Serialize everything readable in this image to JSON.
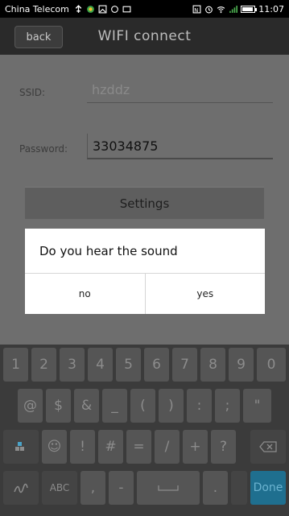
{
  "status_bar": {
    "carrier": "China Telecom",
    "time": "11:07",
    "battery_level": 0.8
  },
  "header": {
    "back_label": "back",
    "title": "WIFI connect"
  },
  "form": {
    "ssid_label": "SSID:",
    "ssid_value": "hzddz",
    "password_label": "Password:",
    "password_value": "33034875",
    "settings_label": "Settings"
  },
  "dialog": {
    "message": "Do you hear the sound",
    "no_label": "no",
    "yes_label": "yes"
  },
  "keyboard": {
    "row1": [
      "1",
      "2",
      "3",
      "4",
      "5",
      "6",
      "7",
      "8",
      "9",
      "0"
    ],
    "row2": [
      "@",
      "$",
      "&",
      "_",
      "(",
      ")",
      ":",
      ";",
      "\""
    ],
    "row3": [
      "☺",
      "!",
      "#",
      "=",
      "/",
      "+",
      "?"
    ],
    "abc_label": "ABC",
    "done_label": "Done"
  },
  "colors": {
    "accent_done": "#1f6f8f"
  }
}
